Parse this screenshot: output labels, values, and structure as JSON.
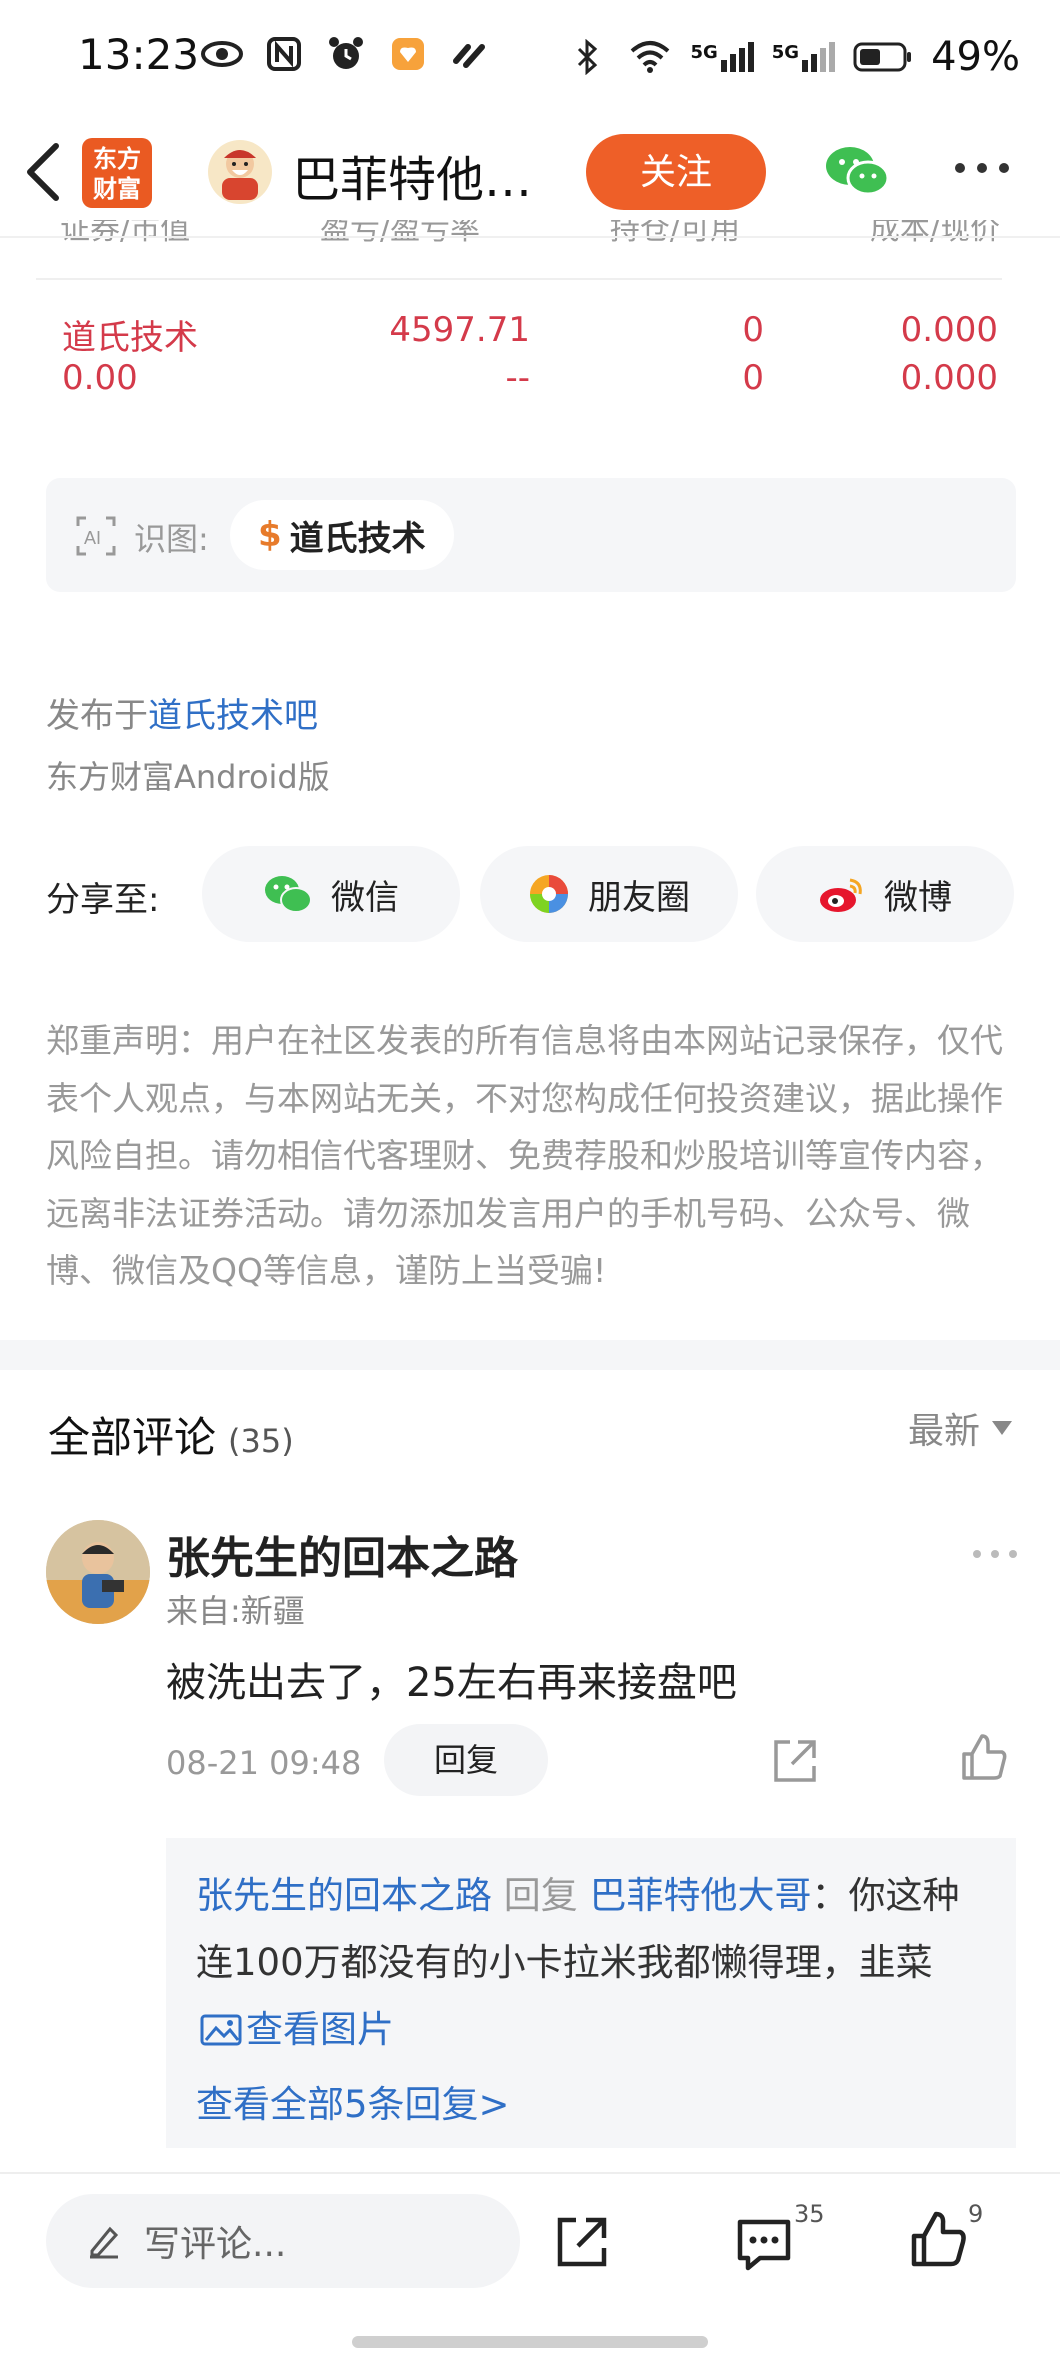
{
  "status_bar": {
    "time": "13:23",
    "network_label_1": "5G",
    "network_label_2": "5G",
    "battery": "49%"
  },
  "nav": {
    "app_logo_line1": "东方",
    "app_logo_line2": "财富",
    "title": "巴菲特他…",
    "follow_label": "关注"
  },
  "table": {
    "header": [
      "证券/市值",
      "盈亏/盈亏率",
      "持仓/可用",
      "成本/现价"
    ],
    "row1": [
      "道氏技术",
      "4597.71",
      "0",
      "0.000"
    ],
    "row2": [
      "0.00",
      "--",
      "0",
      "0.000"
    ]
  },
  "recognize": {
    "label": "识图:",
    "chip": "道氏技术",
    "chip_symbol": "$"
  },
  "publish": {
    "prefix": "发布于",
    "bar_name": "道氏技术吧",
    "version": "东方财富Android版"
  },
  "share": {
    "label": "分享至:",
    "wechat": "微信",
    "moments": "朋友圈",
    "weibo": "微博"
  },
  "disclaimer": "郑重声明：用户在社区发表的所有信息将由本网站记录保存，仅代表个人观点，与本网站无关，不对您构成任何投资建议，据此操作风险自担。请勿相信代客理财、免费荐股和炒股培训等宣传内容，远离非法证券活动。请勿添加发言用户的手机号码、公众号、微博、微信及QQ等信息，谨防上当受骗!",
  "comments": {
    "title": "全部评论",
    "count": "(35)",
    "sort": "最新",
    "items": [
      {
        "user": "张先生的回本之路",
        "location": "来自:新疆",
        "text": "被洗出去了，25左右再来接盘吧",
        "time": "08-21 09:48",
        "reply_label": "回复",
        "reply": {
          "from": "张先生的回本之路",
          "verb": "回复",
          "to": "巴菲特他大哥",
          "content": "：你这种连100万都没有的小卡拉米我都懒得理，韭菜",
          "image_link": "查看图片",
          "view_all": "查看全部5条回复>"
        }
      }
    ]
  },
  "bottom_bar": {
    "write_placeholder": "写评论...",
    "comment_count": "35",
    "like_count": "9"
  },
  "colors": {
    "accent": "#ee5f28",
    "link": "#2f6fc6",
    "stock_red": "#d43a4a"
  }
}
